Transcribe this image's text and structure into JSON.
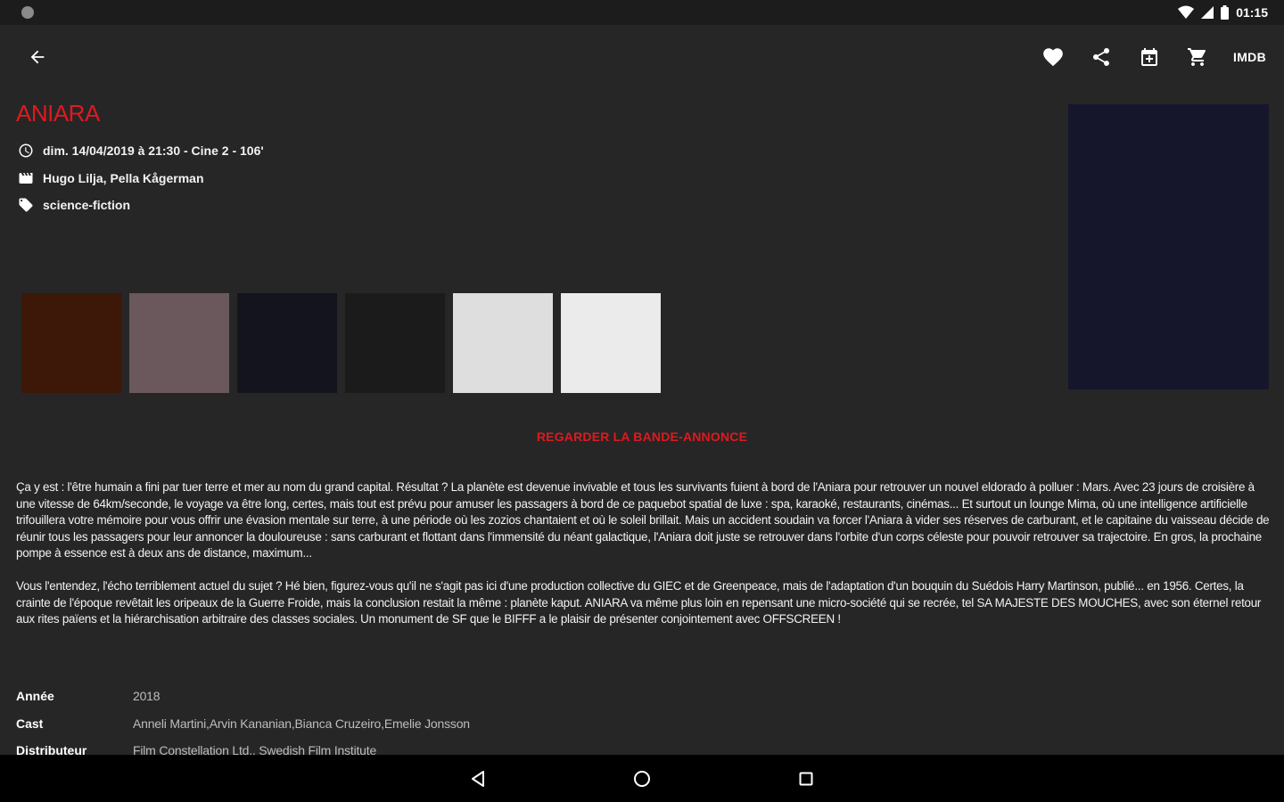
{
  "status_bar": {
    "time": "01:15"
  },
  "toolbar": {
    "back_icon": "arrow-back-icon",
    "actions": [
      "heart-icon",
      "share-icon",
      "calendar-add-icon",
      "cart-icon"
    ],
    "imdb_label": "IMDB"
  },
  "movie": {
    "title": "ANIARA",
    "screening": "dim. 14/04/2019 à 21:30 - Cine 2 - 106'",
    "directors": "Hugo Lilja, Pella Kågerman",
    "genre": "science-fiction"
  },
  "gallery": {
    "colors": [
      "#3d1708",
      "#6a585c",
      "#14141e",
      "#1b1b1b",
      "#dedede",
      "#ebebeb"
    ]
  },
  "trailer_label": "REGARDER LA BANDE-ANNONCE",
  "synopsis": {
    "paragraph1": "Ça y est : l'être humain a fini par tuer terre et mer au nom du grand capital. Résultat ? La planète est devenue invivable et tous les survivants fuient à bord de l'Aniara pour retrouver un nouvel eldorado à polluer : Mars. Avec 23 jours de croisière à une vitesse de 64km/seconde, le voyage va être long, certes, mais tout est prévu pour amuser les passagers à bord de ce paquebot spatial de luxe : spa, karaoké, restaurants, cinémas... Et surtout un lounge Mima, où une intelligence artificielle trifouillera votre mémoire pour vous offrir une évasion mentale sur terre, à une période où les zozios chantaient et où le soleil brillait. Mais un accident soudain va forcer l'Aniara à vider ses réserves de carburant, et le capitaine du vaisseau décide de réunir tous les passagers pour leur annoncer la douloureuse : sans carburant et flottant dans l'immensité du néant galactique, l'Aniara doit juste se retrouver dans l'orbite d'un corps céleste pour pouvoir retrouver sa trajectoire. En gros, la prochaine pompe à essence est à deux ans de distance, maximum...",
    "paragraph2": "Vous l'entendez, l'écho terriblement actuel du sujet ? Hé bien, figurez-vous qu'il ne s'agit pas ici d'une production collective du GIEC et de Greenpeace, mais de l'adaptation d'un bouquin du Suédois Harry Martinson, publié... en 1956. Certes, la crainte de l'époque revêtait les oripeaux de la Guerre Froide, mais la conclusion restait la même : planète kaput. ANIARA va même plus loin en repensant une micro-société qui se recrée, tel SA MAJESTE DES MOUCHES, avec son éternel retour aux rites païens et la hiérarchisation arbitraire des classes sociales. Un monument de SF que le BIFFF a le plaisir de présenter conjointement avec OFFSCREEN !"
  },
  "details": [
    {
      "key": "Année",
      "value": "2018"
    },
    {
      "key": "Cast",
      "value": "Anneli Martini,Arvin Kananian,Bianca Cruzeiro,Emelie Jonsson"
    },
    {
      "key": "Distributeur",
      "value": "Film Constellation Ltd., Swedish Film Institute"
    }
  ],
  "colors": {
    "background": "#262626",
    "accent": "#e0191f",
    "poster": "#15162b"
  }
}
